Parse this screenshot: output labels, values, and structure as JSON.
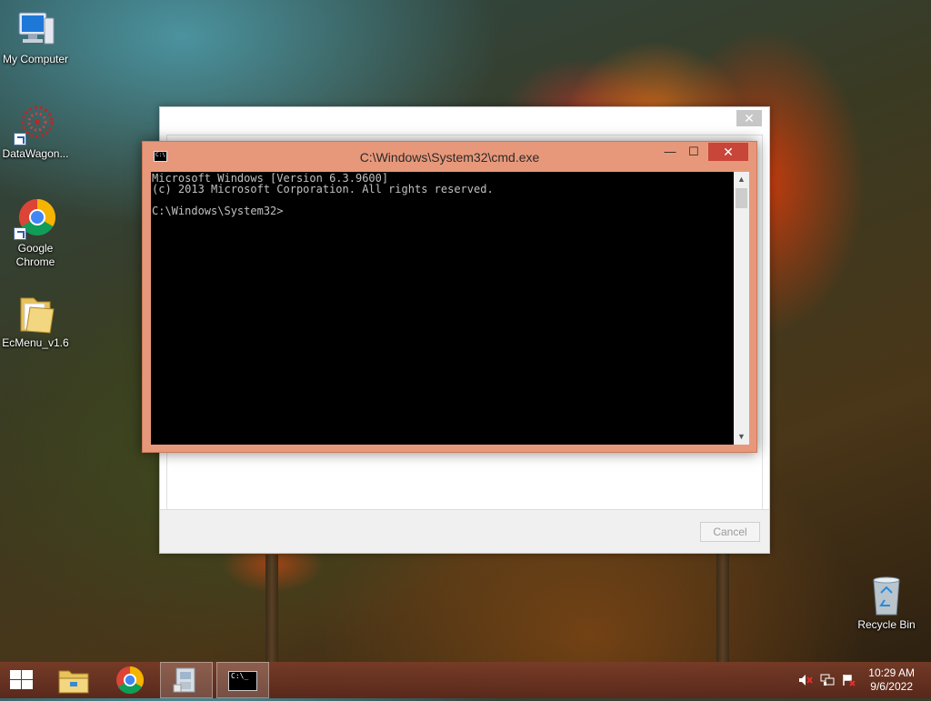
{
  "desktop": {
    "icons": [
      {
        "label": "My Computer"
      },
      {
        "label": "DataWagon..."
      },
      {
        "label": "Google Chrome"
      },
      {
        "label": "EcMenu_v1.6"
      },
      {
        "label": "Recycle Bin"
      }
    ]
  },
  "dialog": {
    "close_glyph": "✕",
    "cancel_label": "Cancel"
  },
  "cmd": {
    "title": "C:\\Windows\\System32\\cmd.exe",
    "icon_text": "C:\\",
    "min_glyph": "—",
    "max_glyph": "☐",
    "close_glyph": "✕",
    "lines": [
      "Microsoft Windows [Version 6.3.9600]",
      "(c) 2013 Microsoft Corporation. All rights reserved.",
      "",
      "C:\\Windows\\System32>"
    ],
    "scroll_up": "▲",
    "scroll_down": "▼"
  },
  "taskbar": {
    "items": [
      "start-icon",
      "file-explorer-icon",
      "chrome-icon",
      "installer-icon",
      "cmd-icon"
    ],
    "cmd_icon_text": "C:\\_",
    "clock": {
      "time": "10:29 AM",
      "date": "9/6/2022"
    }
  }
}
